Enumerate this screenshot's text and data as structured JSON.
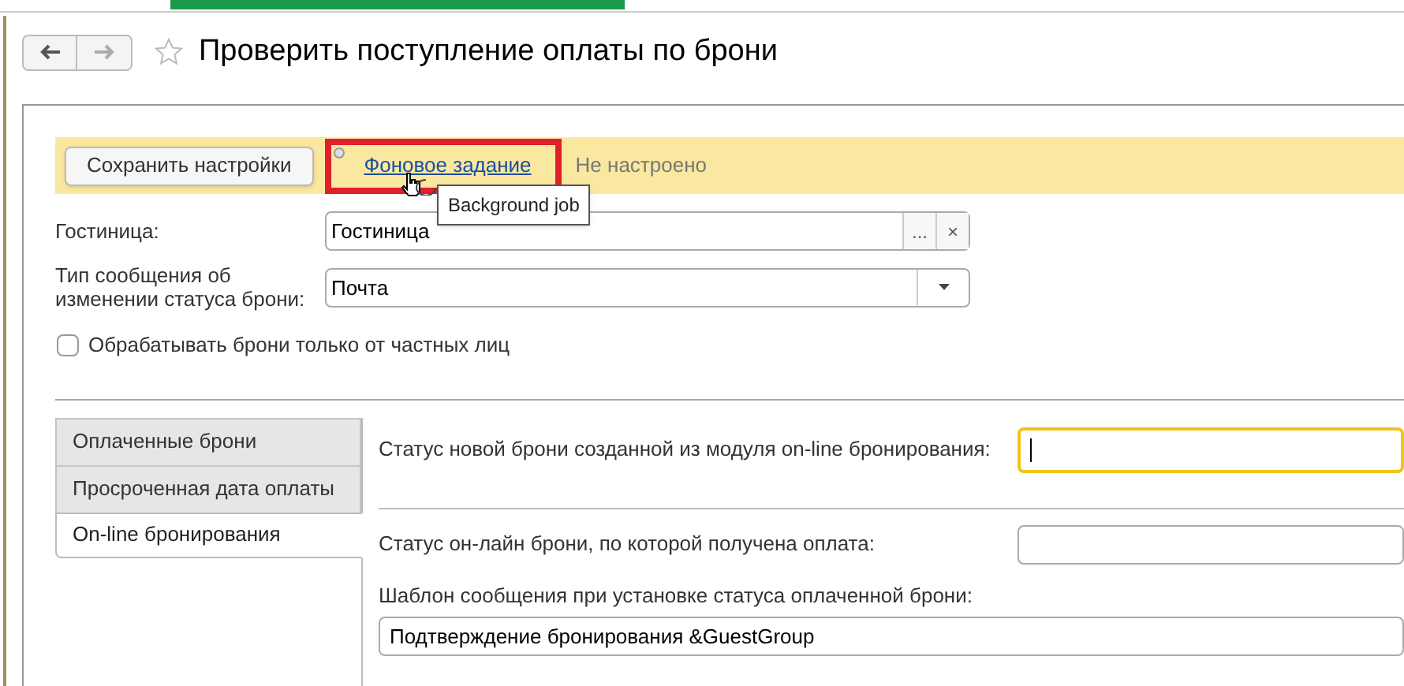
{
  "window": {
    "title": "Проверить поступление оплаты по брони"
  },
  "toolbar": {
    "save_button": "Сохранить настройки",
    "link": "Фоновое задание",
    "link_highlighted": true,
    "status": "Не настроено",
    "tooltip": "Background job"
  },
  "fields": [
    {
      "kind": "picker",
      "label": "Гостиница:",
      "value": "Гостиница",
      "select_button": "...",
      "clear_button": "×"
    },
    {
      "kind": "dropdown",
      "label": "Тип сообщения об изменении статуса брони:",
      "value": "Почта"
    }
  ],
  "checkbox": {
    "label": "Обрабатывать брони только от частных лиц",
    "checked": false
  },
  "tabs": [
    {
      "label": "Оплаченные брони",
      "selected": false
    },
    {
      "label": "Просроченная дата оплаты",
      "selected": false
    },
    {
      "label": "On-line бронирования",
      "selected": true
    }
  ],
  "tab_fields": [
    {
      "kind": "inline",
      "label": "Статус новой брони созданной из модуля on-line бронирования:",
      "focused": true
    },
    {
      "kind": "inline",
      "label": "Статус он-лайн брони, по которой получена оплата:",
      "focused": false
    },
    {
      "kind": "stacked",
      "label": "Шаблон сообщения при установке статуса оплаченной брони:",
      "value": "Подтверждение бронирования &GuestGroup",
      "focused": false
    }
  ]
}
